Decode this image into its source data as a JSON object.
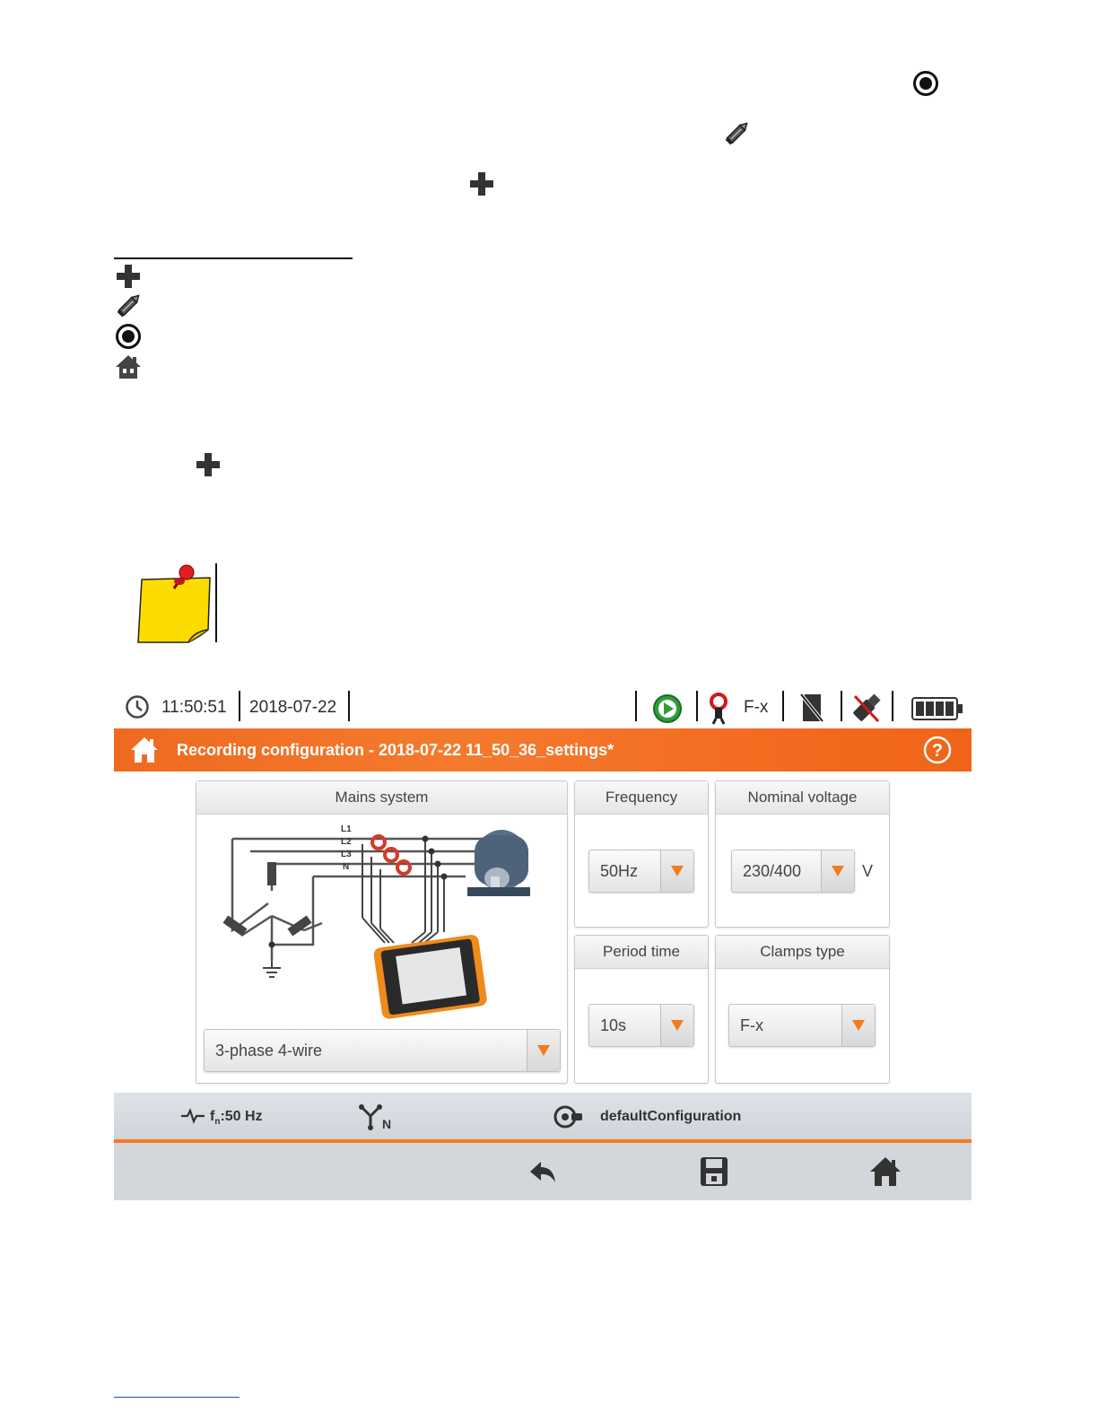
{
  "doc_icons": [
    "record-icon",
    "pencil-icon",
    "plus-icon",
    "plus-icon",
    "pencil-icon",
    "record-icon",
    "home-icon",
    "plus-icon",
    "note-pin-icon"
  ],
  "device": {
    "status": {
      "time": "11:50:51",
      "date": "2018-07-22",
      "clamps": "F-x"
    },
    "title": "Recording configuration - 2018-07-22 11_50_36_settings*",
    "mains": {
      "header": "Mains system",
      "diagram_labels": [
        "L1",
        "L2",
        "L3",
        "N"
      ],
      "selected": "3-phase 4-wire"
    },
    "frequency": {
      "header": "Frequency",
      "selected": "50Hz"
    },
    "nominal_voltage": {
      "header": "Nominal voltage",
      "selected": "230/400",
      "unit": "V"
    },
    "period_time": {
      "header": "Period time",
      "selected": "10s"
    },
    "clamps_type": {
      "header": "Clamps type",
      "selected": "F-x"
    },
    "info": {
      "frequency_prefix": "f",
      "frequency_sub": "n",
      "frequency_value": ":50 Hz",
      "config_name": "defaultConfiguration"
    },
    "colors": {
      "accent": "#f47a1f",
      "bar": "#d3d7dc"
    }
  }
}
